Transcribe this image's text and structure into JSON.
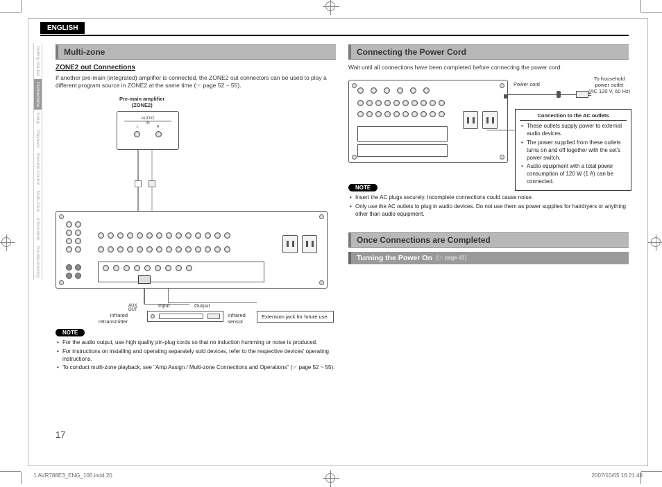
{
  "language_tab": "ENGLISH",
  "sidetabs": [
    "Getting Started",
    "Connections",
    "Setup",
    "Playback",
    "Remote Control",
    "Multi-Zone",
    "Information",
    "Troubleshooting"
  ],
  "sidetab_active_index": 1,
  "left": {
    "section": "Multi-zone",
    "sub": "ZONE2 out Connections",
    "intro": "If another pre-main (integrated) amplifier is connected, the ZONE2 out connectors can be used to play a different program source in ZONE2 at the same time (☞ page 52 ~ 55).",
    "premain_label": "Pre-main amplifier\n(ZONE2)",
    "premain_audio": "AUDIO",
    "premain_in": "IN",
    "premain_L": "L",
    "premain_R": "R",
    "aux_out": "AUX\nOUT",
    "input": "Input",
    "output": "Output",
    "ir_retrans": "Infrared\nretransmitter",
    "ir_sensor": "Infrared\nsensor",
    "ext_jack": "Extension jack for future use.",
    "note_label": "NOTE",
    "notes": [
      "For the audio output, use high quality pin-plug cords so that no induction humming or noise is produced.",
      "For instructions on installing and operating separately sold devices, refer to the respective devices' operating instructions.",
      "To conduct multi-zone playback, see \"Amp Assign / Multi-zone Connections and Operations\" (☞ page 52 ~ 55)."
    ]
  },
  "right": {
    "section1": "Connecting the Power Cord",
    "wait": "Wait until all connections have been completed before connecting the power cord.",
    "power_cord": "Power cord",
    "household": "To household\npower outlet\n(AC 120 V, 60 Hz)",
    "conn_title": "Connection to the AC outlets",
    "conn_items": [
      "These outlets supply power to external audio devices.",
      "The power supplied from these outlets turns on and off together with the set's power switch.",
      "Audio equipment with a total power consumption of 120 W (1 A) can be connected."
    ],
    "note_label": "NOTE",
    "notes": [
      "Insert the AC plugs securely. Incomplete connections could cause noise.",
      "Only use the AC outlets to plug in audio devices. Do not use them as power supplies for hairdryers or anything other than audio equipment."
    ],
    "section2": "Once Connections are Completed",
    "turning_on": "Turning the Power On",
    "turning_on_ref": "(☞ page 41)"
  },
  "page_number": "17",
  "footer_left": "1.AVR788E3_ENG_106.indd   20",
  "footer_right": "2007/10/05   16:21:46"
}
